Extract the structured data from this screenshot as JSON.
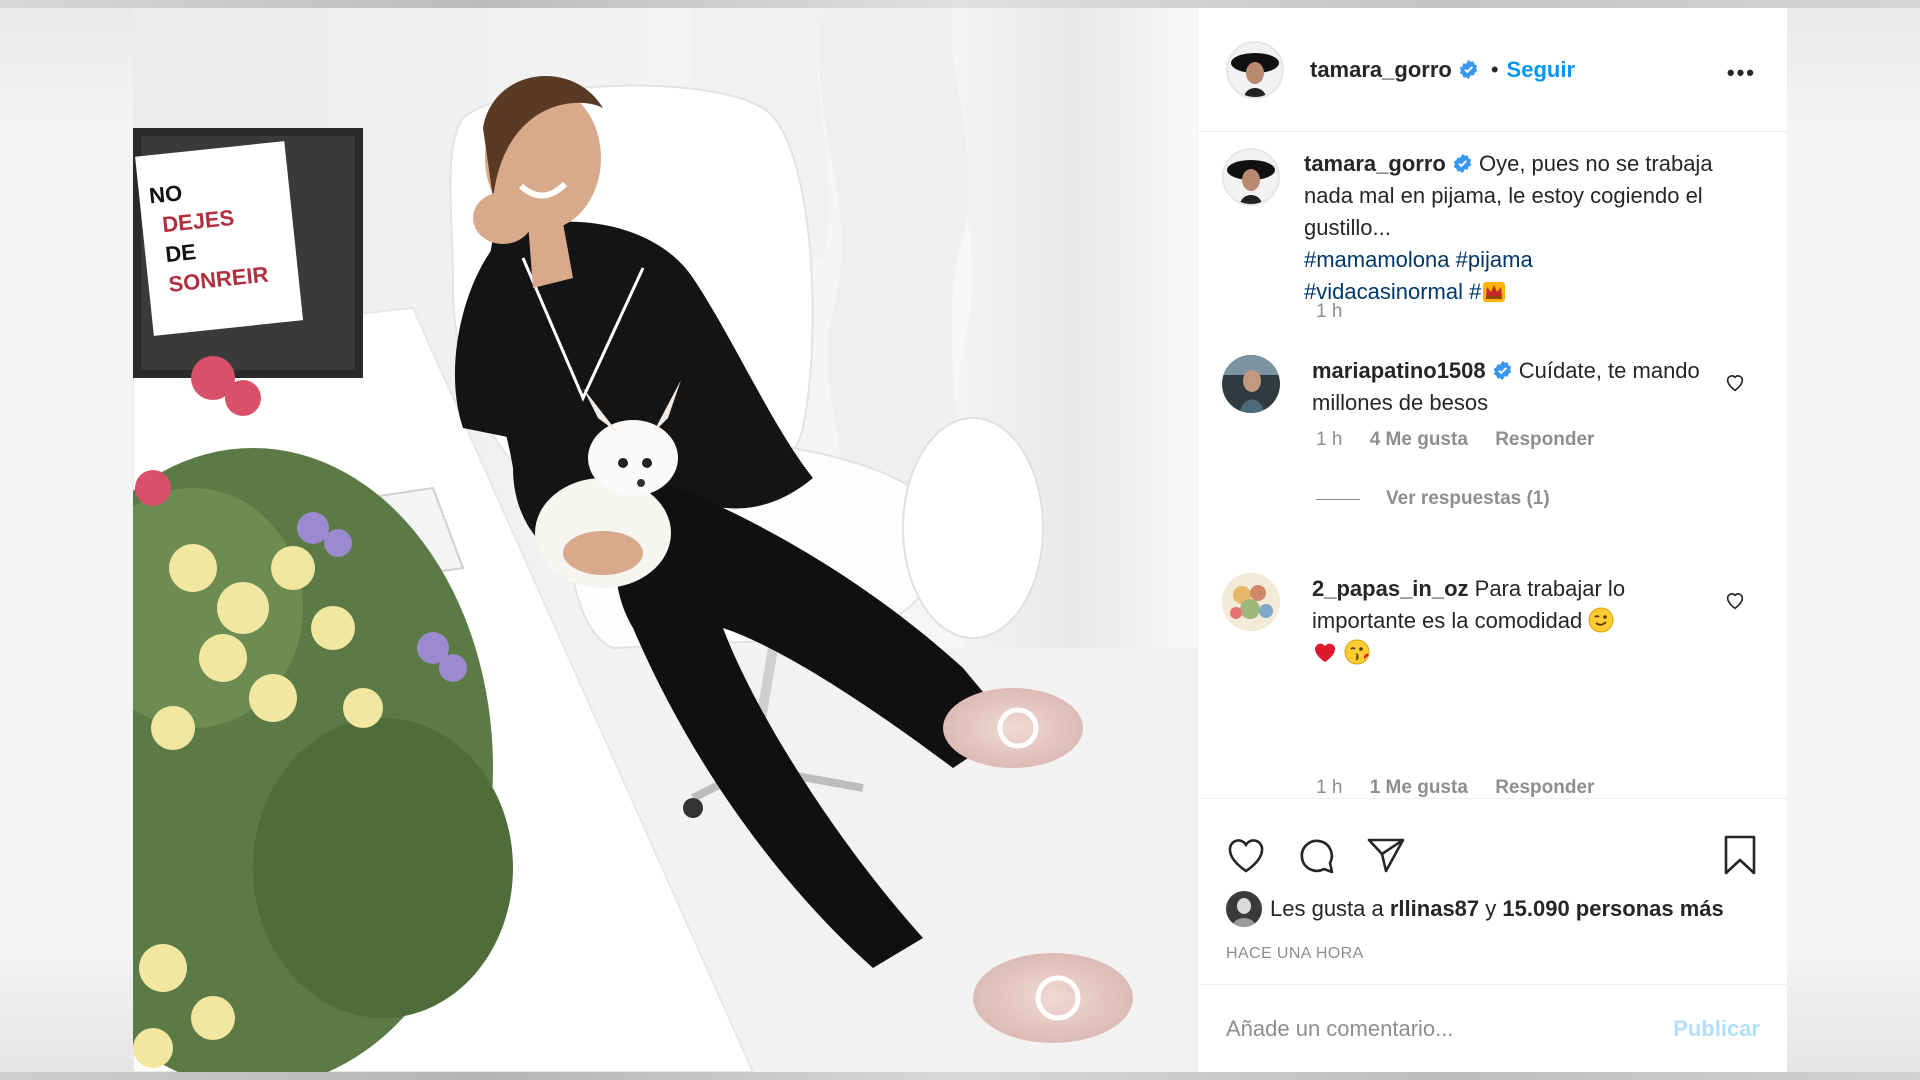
{
  "post": {
    "author": "tamara_gorro",
    "follow_label": "Seguir",
    "dot": "•",
    "more_label": "•••"
  },
  "photo": {
    "sign_lines": [
      "NO",
      "DEJES",
      "DE",
      "SONREIR"
    ]
  },
  "caption": {
    "username": "tamara_gorro",
    "text": "Oye, pues no se trabaja nada mal en pijama, le estoy cogiendo el gustillo...",
    "hashtags": [
      "#mamamolona",
      "#pijama",
      "#vidacasinormal",
      "#"
    ],
    "time": "1 h"
  },
  "comments": [
    {
      "username": "mariapatino1508",
      "text": "Cuídate, te mando millones de besos",
      "time": "1 h",
      "likes": "4 Me gusta",
      "reply": "Responder",
      "view_replies": "Ver respuestas (1)"
    },
    {
      "username": "2_papas_in_oz",
      "text": "Para trabajar lo importante es la comodidad",
      "time": "1 h",
      "likes": "1 Me gusta",
      "reply": "Responder"
    }
  ],
  "likes_line": {
    "prefix": "Les gusta a",
    "user": "rllinas87",
    "middle": "y",
    "count": "15.090 personas más"
  },
  "posted": "HACE UNA HORA",
  "add_comment": {
    "placeholder": "Añade un comentario...",
    "publish": "Publicar"
  },
  "colors": {
    "accent": "#0095f6",
    "hashtag": "#00376b",
    "muted": "#8e8e8e",
    "publish_disabled": "#b2dffc"
  },
  "icons": [
    "heart-icon",
    "comment-icon",
    "share-icon",
    "bookmark-icon",
    "verified-icon",
    "more-icon",
    "crown-emoji",
    "wink-emoji",
    "red-heart-emoji",
    "kiss-emoji"
  ]
}
